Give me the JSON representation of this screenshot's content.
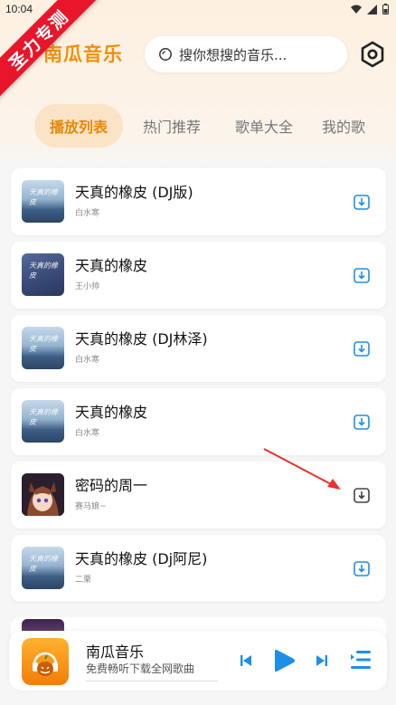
{
  "status_bar": {
    "time": "10:04"
  },
  "ribbon": {
    "label": "圣力专测"
  },
  "header": {
    "app_title": "南瓜音乐",
    "search_placeholder": "搜你想搜的音乐...",
    "settings_icon": "gear-hexagon-icon"
  },
  "tabs": [
    {
      "label": "播放列表",
      "active": true
    },
    {
      "label": "热门推荐",
      "active": false
    },
    {
      "label": "歌单大全",
      "active": false
    },
    {
      "label": "我的歌",
      "active": false
    }
  ],
  "songs": [
    {
      "title": "天真的橡皮 (DJ版)",
      "artist": "白水寒",
      "cover": "sea"
    },
    {
      "title": "天真的橡皮",
      "artist": "王小帅",
      "cover": "night"
    },
    {
      "title": "天真的橡皮 (DJ林泽)",
      "artist": "白水寒",
      "cover": "sea"
    },
    {
      "title": "天真的橡皮",
      "artist": "白水寒",
      "cover": "sea"
    },
    {
      "title": "密码的周一",
      "artist": "赛马娘~",
      "cover": "anime"
    },
    {
      "title": "天真的橡皮 (Dj阿尼)",
      "artist": "二栗",
      "cover": "sea"
    }
  ],
  "player": {
    "title": "南瓜音乐",
    "subtitle": "免费畅听下载全网歌曲",
    "prev_icon": "skip-previous-icon",
    "play_icon": "play-icon",
    "next_icon": "skip-next-icon",
    "playlist_icon": "playlist-icon"
  },
  "colors": {
    "accent": "#f0900a",
    "tab_active_bg": "#fbe3c6",
    "player_blue": "#1e8fe8",
    "ribbon_red": "#e8152b",
    "arrow_red": "#e8322b"
  }
}
